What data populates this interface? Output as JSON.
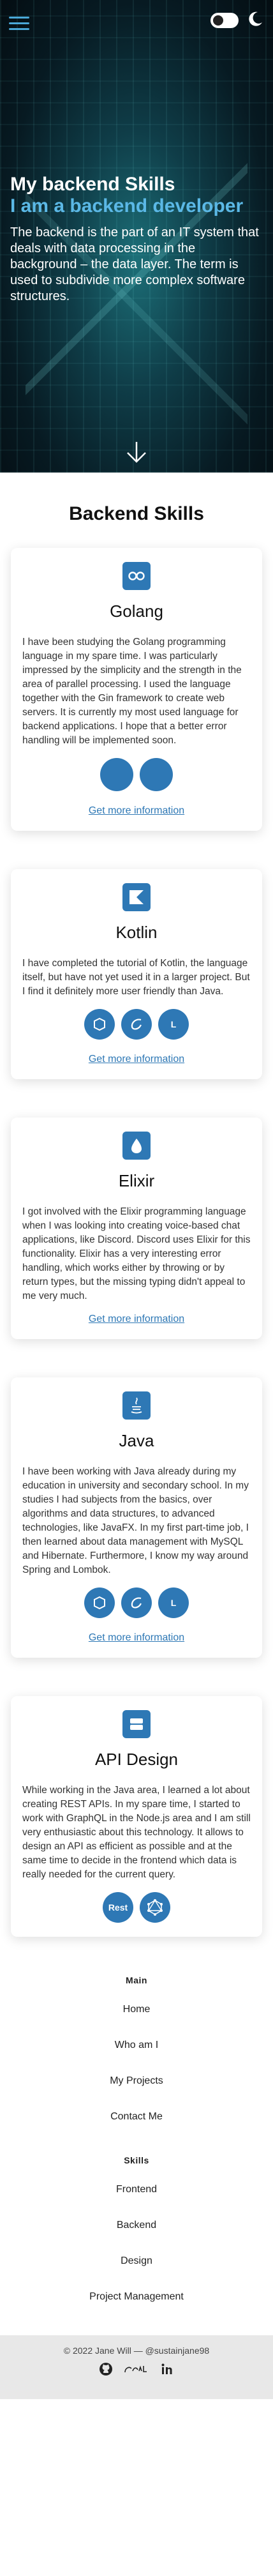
{
  "hero": {
    "title": "My backend Skills",
    "subtitle": "I am a backend developer",
    "description": "The backend is the part of an IT system that deals with data processing in the background – the data layer. The term is used to subdivide more complex software structures."
  },
  "skills_title": "Backend Skills",
  "cards": [
    {
      "title": "Golang",
      "text": "I have been studying the Golang programming language in my spare time. I was particularly impressed by the simplicity and the strength in the area of parallel processing. I used the language together with the Gin framework to create web servers. It is currently my most used language for backend applications. I hope that a better error handling will be implemented soon.",
      "link": "Get more information"
    },
    {
      "title": "Kotlin",
      "text": "I have completed the tutorial of Kotlin, the language itself, but have not yet used it in a larger project. But I find it definitely more user friendly than Java.",
      "badge_letter": "L",
      "link": "Get more information"
    },
    {
      "title": "Elixir",
      "text": "I got involved with the Elixir programming language when I was looking into creating voice-based chat applications, like Discord. Discord uses Elixir for this functionality. Elixir has a very interesting error handling, which works either by throwing or by return types, but the missing typing didn't appeal to me very much.",
      "link": "Get more information"
    },
    {
      "title": "Java",
      "text": "I have been working with Java already during my education in university and secondary school. In my studies I had subjects from the basics, over algorithms and data structures, to advanced technologies, like JavaFX. In my first part-time job, I then learned about data management with MySQL and Hibernate. Furthermore, I know my way around Spring and Lombok.",
      "badge_letter": "L",
      "link": "Get more information"
    },
    {
      "title": "API Design",
      "text": "While working in the Java area, I learned a lot about creating REST APIs. In my spare time, I started to work with GraphQL in the Node.js area and I am still very enthusiastic about this technology. It allows to design an API as efficient as possible and at the same time to decide in the frontend which data is really needed for the current query.",
      "badge_rest": "Rest"
    }
  ],
  "footer": {
    "main_heading": "Main",
    "main_links": [
      "Home",
      "Who am I",
      "My Projects",
      "Contact Me"
    ],
    "skills_heading": "Skills",
    "skills_links": [
      "Frontend",
      "Backend",
      "Design",
      "Project Management"
    ],
    "copyright": "© 2022 Jane Will — @sustainjane98",
    "socials": [
      "github-icon",
      "gitlab-icon",
      "linkedin-icon"
    ]
  },
  "colors": {
    "accent": "#2e78b5",
    "hero_subtitle": "#5bb8e6",
    "footer_bg": "#e8e8e8"
  }
}
